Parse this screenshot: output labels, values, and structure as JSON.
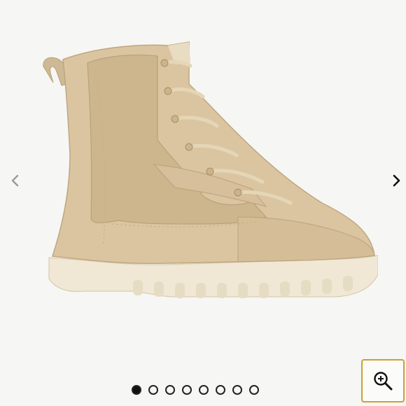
{
  "viewer": {
    "slides": [
      {
        "active": true
      },
      {
        "active": false
      },
      {
        "active": false
      },
      {
        "active": false
      },
      {
        "active": false
      },
      {
        "active": false
      },
      {
        "active": false
      },
      {
        "active": false
      }
    ],
    "prev_icon": "chevron-left-icon",
    "next_icon": "chevron-right-icon",
    "zoom_icon": "zoom-in-icon"
  },
  "colors": {
    "background": "#f6f6f4",
    "boot_suede": "#d9c3a0",
    "boot_canvas": "#cdb68e",
    "sole": "#f0e8d4",
    "zoom_border": "#c9a233"
  }
}
